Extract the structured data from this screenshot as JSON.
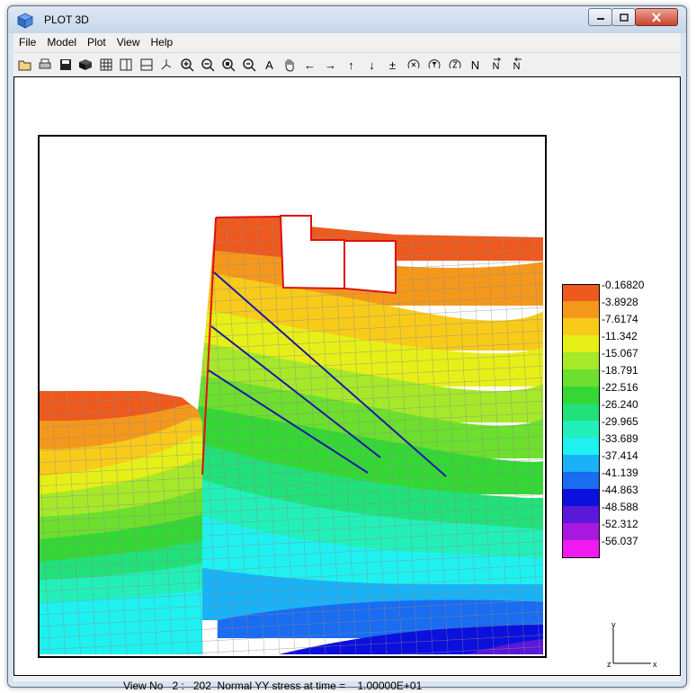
{
  "window": {
    "title": "PLOT 3D"
  },
  "menu": {
    "items": [
      "File",
      "Model",
      "Plot",
      "View",
      "Help"
    ]
  },
  "toolbar": {
    "buttons": [
      {
        "name": "open-icon"
      },
      {
        "name": "print-icon"
      },
      {
        "name": "save-icon"
      },
      {
        "name": "view-3d-icon"
      },
      {
        "name": "mesh-grid-icon"
      },
      {
        "name": "split-vertical-icon"
      },
      {
        "name": "split-horizontal-icon"
      },
      {
        "name": "rotate-axes-icon"
      },
      {
        "name": "zoom-in-icon"
      },
      {
        "name": "zoom-out-icon"
      },
      {
        "name": "zoom-window-icon"
      },
      {
        "name": "zoom-previous-icon"
      },
      {
        "name": "text-annotation-icon",
        "glyph": "A"
      },
      {
        "name": "pan-hand-icon"
      },
      {
        "name": "arrow-left-icon",
        "glyph": "←"
      },
      {
        "name": "arrow-right-icon",
        "glyph": "→"
      },
      {
        "name": "arrow-up-icon",
        "glyph": "↑"
      },
      {
        "name": "arrow-down-icon",
        "glyph": "↓"
      },
      {
        "name": "plus-minus-icon",
        "glyph": "±"
      },
      {
        "name": "rotate-x-icon"
      },
      {
        "name": "rotate-y-icon"
      },
      {
        "name": "rotate-z-icon"
      },
      {
        "name": "normal-view-icon",
        "glyph": "N"
      },
      {
        "name": "normal-next-icon",
        "glyph": "N"
      },
      {
        "name": "normal-previous-icon",
        "glyph": "N"
      }
    ]
  },
  "legend": {
    "items": [
      {
        "label": "-0.16820",
        "color": "#ee5a1e"
      },
      {
        "label": "-3.8928",
        "color": "#f4981c"
      },
      {
        "label": "-7.6174",
        "color": "#f8cb1a"
      },
      {
        "label": "-11.342",
        "color": "#e6ef17"
      },
      {
        "label": "-15.067",
        "color": "#a6e82a"
      },
      {
        "label": "-18.791",
        "color": "#6ddf2e"
      },
      {
        "label": "-22.516",
        "color": "#35d735"
      },
      {
        "label": "-26.240",
        "color": "#22e07a"
      },
      {
        "label": "-29.965",
        "color": "#22f0b8"
      },
      {
        "label": "-33.689",
        "color": "#1ef1f0"
      },
      {
        "label": "-37.414",
        "color": "#1ab2f6"
      },
      {
        "label": "-41.139",
        "color": "#1a6cf0"
      },
      {
        "label": "-44.863",
        "color": "#0c10dc"
      },
      {
        "label": "-48.588",
        "color": "#5a18d8"
      },
      {
        "label": "-52.312",
        "color": "#a818e0"
      },
      {
        "label": "-56.037",
        "color": "#f01af0"
      }
    ]
  },
  "status": {
    "view_label": "View No",
    "view_number": "2",
    "step": "202",
    "description": "Normal YY stress at time =",
    "time": "1.00000E+01"
  },
  "axes": {
    "y_label": "y",
    "z_label": "z",
    "x_label": "x"
  }
}
